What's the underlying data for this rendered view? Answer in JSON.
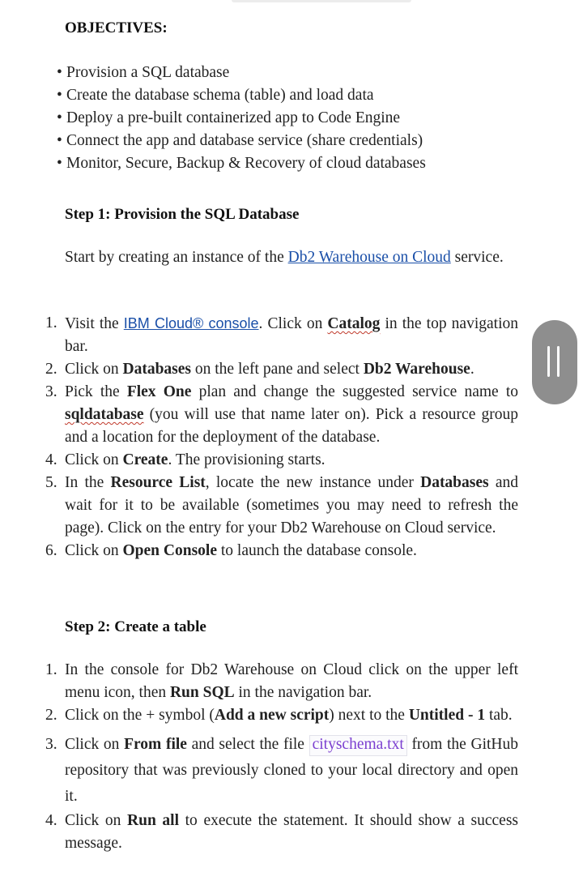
{
  "objectives": {
    "heading": "OBJECTIVES:",
    "items": [
      "Provision a SQL database",
      "Create the database schema (table) and load data",
      "Deploy a pre-built containerized app to Code Engine",
      "Connect the app and database service (share credentials)",
      "Monitor, Secure, Backup & Recovery of cloud databases"
    ]
  },
  "step1": {
    "heading": "Step 1: Provision the SQL Database",
    "intro_before": "Start by creating an instance of the ",
    "intro_link": "Db2 Warehouse on Cloud",
    "intro_after": " service.",
    "items": {
      "n1": "1.",
      "i1_a": "Visit the ",
      "i1_link": "IBM Cloud® console",
      "i1_b": ". Click on ",
      "i1_bold": "Catalog",
      "i1_c": " in the top navigation bar.",
      "n2": "2.",
      "i2_a": "Click on ",
      "i2_bold1": "Databases",
      "i2_b": " on the left pane and select ",
      "i2_bold2": "Db2 Warehouse",
      "i2_c": ".",
      "n3": "3.",
      "i3_a": "Pick the ",
      "i3_bold1": "Flex One",
      "i3_b": " plan and change the suggested service name to ",
      "i3_bold2": "sqldatabase",
      "i3_c": " (you will use that name later on). Pick a resource group and a location for the deployment of the database.",
      "n4": "4.",
      "i4_a": "Click on ",
      "i4_bold": "Create",
      "i4_b": ". The provisioning starts.",
      "n5": "5.",
      "i5_a": "In the ",
      "i5_bold1": "Resource List",
      "i5_b": ", locate the new instance under ",
      "i5_bold2": "Databases",
      "i5_c": " and wait for it to be available (sometimes you may need to refresh the page). Click on the entry for your Db2 Warehouse on Cloud service.",
      "n6": "6.",
      "i6_a": "Click on ",
      "i6_bold": "Open Console",
      "i6_b": " to launch the database console."
    }
  },
  "step2": {
    "heading": "Step 2: Create a table",
    "items": {
      "n1": "1.",
      "i1_a": "In the console for Db2 Warehouse on Cloud click on the upper left menu icon, then ",
      "i1_bold": "Run SQL",
      "i1_b": " in the navigation bar.",
      "n2": "2.",
      "i2_a": "Click on the + symbol (",
      "i2_bold1": "Add a new script",
      "i2_b": ") next to the ",
      "i2_bold2": "Untitled - 1",
      "i2_c": " tab.",
      "n3": "3.",
      "i3_a": "Click on ",
      "i3_bold": "From file",
      "i3_b": " and select the file ",
      "i3_code": "cityschema.txt",
      "i3_c": " from the GitHub repository that was previously cloned to your local directory and open it.",
      "n4": "4.",
      "i4_a": "Click on ",
      "i4_bold": "Run all",
      "i4_b": " to execute the statement. It should show a success message."
    }
  }
}
